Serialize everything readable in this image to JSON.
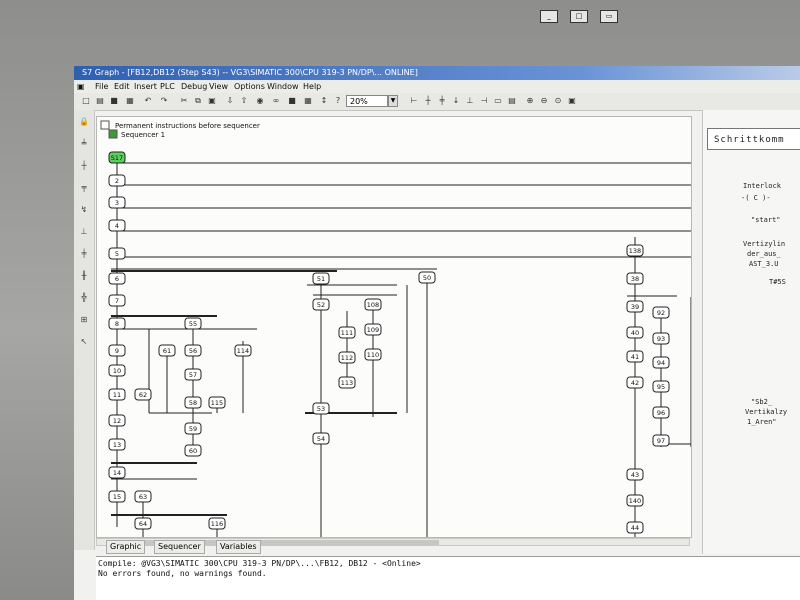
{
  "window": {
    "title": "S7 Graph - [FB12,DB12 (Step S43) -- VG3\\SIMATIC 300\\CPU 319-3 PN/DP\\...  ONLINE]"
  },
  "menu": [
    "File",
    "Edit",
    "Insert",
    "PLC",
    "Debug",
    "View",
    "Options",
    "Window",
    "Help"
  ],
  "toolbar": {
    "zoom": "20%"
  },
  "tree": {
    "header": "Permanent instructions before sequencer",
    "sequencer": "Sequencer 1"
  },
  "steps": [
    "S17",
    "2",
    "3",
    "4",
    "5",
    "6",
    "7",
    "8",
    "9",
    "10",
    "11",
    "12",
    "13",
    "14",
    "15",
    "61",
    "62",
    "55",
    "56",
    "57",
    "58",
    "59",
    "60",
    "63",
    "64",
    "114",
    "115",
    "116",
    "51",
    "52",
    "53",
    "54",
    "111",
    "112",
    "113",
    "108",
    "109",
    "110",
    "50",
    "138",
    "38",
    "39",
    "40",
    "41",
    "42",
    "92",
    "93",
    "94",
    "95",
    "96",
    "97",
    "43",
    "140",
    "44"
  ],
  "active_step": "S17",
  "right_pane": {
    "title": "Schrittkomm",
    "lines": [
      "Interlock",
      "-( C )-",
      "\"start\"",
      "Vertizylin",
      "der_aus_",
      "AST_3.U",
      "T#5S",
      "\"Sb2_",
      "Vertikalzy",
      "1_Aren\""
    ]
  },
  "tabs": [
    "Graphic",
    "Sequencer",
    "Variables"
  ],
  "output": {
    "line1": "Compile: @VG3\\SIMATIC 300\\CPU 319-3 PN/DP\\...\\FB12, DB12 - <Online>",
    "line2": "No errors found, no warnings found."
  }
}
